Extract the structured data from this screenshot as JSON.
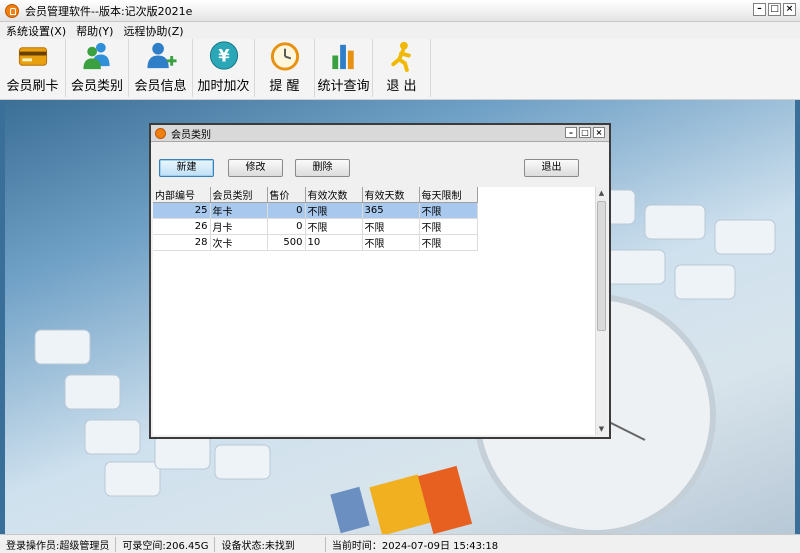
{
  "window": {
    "title": "会员管理软件--版本:记次版2021e"
  },
  "menu": [
    {
      "label": "系统设置(X)"
    },
    {
      "label": "帮助(Y)"
    },
    {
      "label": "远程协助(Z)"
    }
  ],
  "toolbar": [
    {
      "label": "会员刷卡",
      "icon": "card-icon"
    },
    {
      "label": "会员类别",
      "icon": "users-icon"
    },
    {
      "label": "会员信息",
      "icon": "user-add-icon"
    },
    {
      "label": "加时加次",
      "icon": "yen-icon"
    },
    {
      "label": "提 醒",
      "icon": "clock-icon"
    },
    {
      "label": "统计查询",
      "icon": "bar-chart-icon"
    },
    {
      "label": "退 出",
      "icon": "exit-person-icon"
    }
  ],
  "dialog": {
    "title": "会员类别",
    "buttons": {
      "new": "新建",
      "edit": "修改",
      "delete": "删除",
      "exit": "退出"
    },
    "columns": [
      "内部编号",
      "会员类别",
      "售价",
      "有效次数",
      "有效天数",
      "每天限制"
    ],
    "rows": [
      [
        "25",
        "年卡",
        "0",
        "不限",
        "365",
        "不限"
      ],
      [
        "26",
        "月卡",
        "0",
        "不限",
        "不限",
        "不限"
      ],
      [
        "28",
        "次卡",
        "500",
        "10",
        "不限",
        "不限"
      ]
    ]
  },
  "status": {
    "operator": "登录操作员:超级管理员",
    "space": "可录空间:206.45G",
    "device": "设备状态:未找到",
    "time": "当前时间：2024-07-09日 15:43:18"
  },
  "colors": {
    "selection": "#a8c8ee",
    "desktop": "#3a6f9a",
    "accent": "#f08010"
  }
}
